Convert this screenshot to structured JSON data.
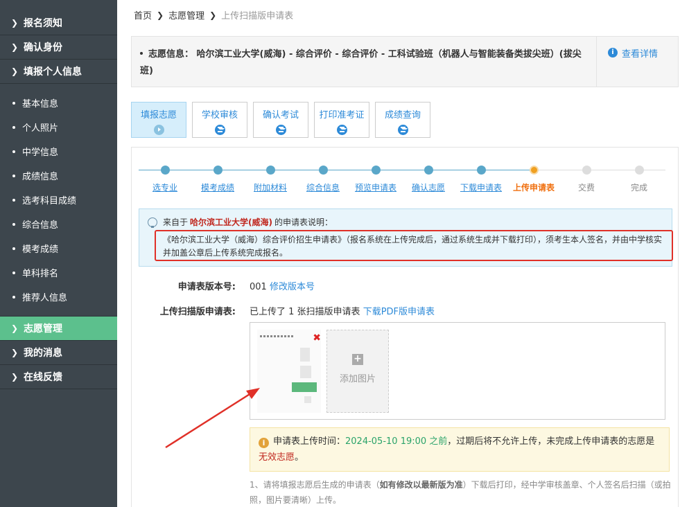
{
  "sidebar": {
    "top_items": [
      {
        "label": "报名须知"
      },
      {
        "label": "确认身份"
      },
      {
        "label": "填报个人信息"
      }
    ],
    "sub_items": [
      {
        "label": "基本信息"
      },
      {
        "label": "个人照片"
      },
      {
        "label": "中学信息"
      },
      {
        "label": "成绩信息"
      },
      {
        "label": "选考科目成绩"
      },
      {
        "label": "综合信息"
      },
      {
        "label": "模考成绩"
      },
      {
        "label": "单科排名"
      },
      {
        "label": "推荐人信息"
      }
    ],
    "bottom_items": [
      {
        "label": "志愿管理",
        "active": true
      },
      {
        "label": "我的消息"
      },
      {
        "label": "在线反馈"
      }
    ]
  },
  "breadcrumb": {
    "home": "首页",
    "level1": "志愿管理",
    "current": "上传扫描版申请表"
  },
  "info": {
    "label": "志愿信息：",
    "text": "哈尔滨工业大学(威海) - 综合评价 - 综合评价 - 工科试验班（机器人与智能装备类拔尖班）(拔尖班)",
    "detail_link": "查看详情"
  },
  "tabs": [
    {
      "label": "填报志愿",
      "icon": "play-icon"
    },
    {
      "label": "学校审核",
      "icon": "hourglass-icon"
    },
    {
      "label": "确认考试",
      "icon": "hourglass-icon"
    },
    {
      "label": "打印准考证",
      "icon": "hourglass-icon"
    },
    {
      "label": "成绩查询",
      "icon": "hourglass-icon"
    }
  ],
  "steps": [
    {
      "label": "选专业",
      "state": "done"
    },
    {
      "label": "模考成绩",
      "state": "done"
    },
    {
      "label": "附加材料",
      "state": "done"
    },
    {
      "label": "综合信息",
      "state": "done"
    },
    {
      "label": "预览申请表",
      "state": "done"
    },
    {
      "label": "确认志愿",
      "state": "done"
    },
    {
      "label": "下载申请表",
      "state": "done"
    },
    {
      "label": "上传申请表",
      "state": "current"
    },
    {
      "label": "交费",
      "state": "todo"
    },
    {
      "label": "完成",
      "state": "todo"
    }
  ],
  "notice": {
    "prefix": "来自于",
    "school": "哈尔滨工业大学(威海)",
    "suffix": "的申请表说明：",
    "body": "《哈尔滨工业大学（威海）综合评价招生申请表》（报名系统在上传完成后，通过系统生成并下载打印），须考生本人签名，并由中学核实并加盖公章后上传系统完成报名。"
  },
  "form": {
    "version_label": "申请表版本号:",
    "version_value": "001",
    "version_link": "修改版本号",
    "upload_label": "上传扫描版申请表:",
    "upload_status": "已上传了 1 张扫描版申请表",
    "download_link": "下载PDF版申请表",
    "add_image": "添加图片"
  },
  "warning": {
    "prefix": "申请表上传时间：",
    "deadline": "2024-05-10 19:00 之前",
    "middle": "，过期后将不允许上传，未完成上传申请表的志愿是",
    "red": "无效志愿",
    "end": "。"
  },
  "note": {
    "p1": "1、请将填报志愿后生成的申请表（",
    "bold": "如有修改以最新版为准",
    "p2": "）下载后打印，经中学审核盖章、个人签名后扫描（或拍照，图片要清晰）上传。"
  },
  "colors": {
    "sidebar_bg": "#3d464d",
    "sidebar_active": "#5cc08d",
    "link": "#2d8ad8",
    "current_step": "#f07010",
    "highlight_red": "#e03028"
  }
}
